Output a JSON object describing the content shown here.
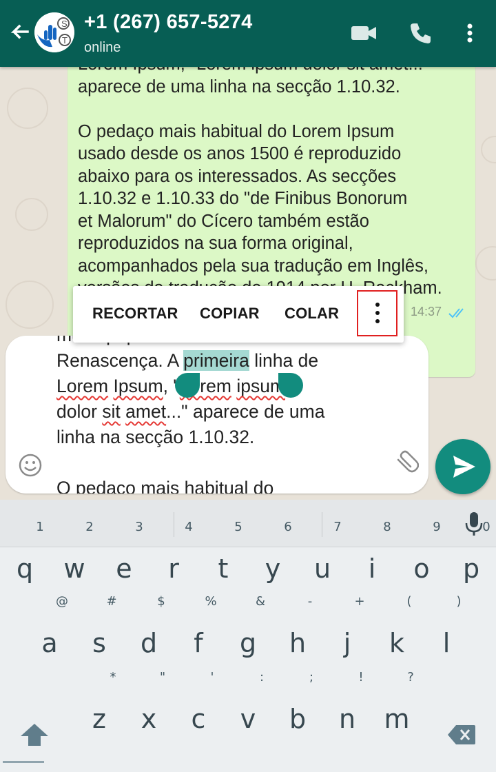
{
  "header": {
    "contact_name": "+1 (267) 657-5274",
    "status": "online",
    "icons": [
      "back-arrow-icon",
      "avatar",
      "video-call-icon",
      "phone-icon",
      "more-vert-icon"
    ],
    "bg_color": "#075e54"
  },
  "message": {
    "text": "Lorem Ipsum, \"Lorem ipsum dolor sit amet...\"\naparece de uma linha na secção 1.10.32.\n\nO pedaço mais habitual do Lorem Ipsum\nusado desde os anos 1500 é reproduzido\nabaixo para os interessados. As secções\n1.10.32 e 1.10.33 do \"de Finibus Bonorum\net Malorum\" do Cícero também estão\nreproduzidos na sua forma original,\nacompanhados pela sua tradução em Inglês,\nversões da tradução de 1914 por H. Rackham.",
    "time": "14:37",
    "bubble_color": "#dcf8c6"
  },
  "context_menu": {
    "cut": "RECORTAR",
    "copy": "COPIAR",
    "paste": "COLAR"
  },
  "input": {
    "line0": "muito popular durante a",
    "line1_pre": "Renascença. A ",
    "line1_sel": "primeira",
    "line1_post": " linha de",
    "line2_a": "Lorem",
    "line2_b": " ",
    "line2_c": "Ipsum",
    "line2_d": ", \"",
    "line2_e": "Lorem",
    "line2_f": " ",
    "line2_g": "ipsum",
    "line3_a": "dolor ",
    "line3_b": "sit",
    "line3_c": " ",
    "line3_d": "amet",
    "line3_e": "...\" aparece de uma",
    "line4": "linha na secção 1.10.32.",
    "line5": "",
    "line6": "O pedaço mais habitual do",
    "selection_color": "#a5d9d2",
    "spellcheck_color": "#e53935"
  },
  "keyboard": {
    "row1": [
      {
        "k": "q",
        "h": "1"
      },
      {
        "k": "w",
        "h": "2"
      },
      {
        "k": "e",
        "h": "3"
      },
      {
        "k": "r",
        "h": "4"
      },
      {
        "k": "t",
        "h": "5"
      },
      {
        "k": "y",
        "h": "6"
      },
      {
        "k": "u",
        "h": "7"
      },
      {
        "k": "i",
        "h": "8"
      },
      {
        "k": "o",
        "h": "9"
      },
      {
        "k": "p",
        "h": "0"
      }
    ],
    "row2": [
      {
        "k": "a",
        "h": "@"
      },
      {
        "k": "s",
        "h": "#"
      },
      {
        "k": "d",
        "h": "$"
      },
      {
        "k": "f",
        "h": "%"
      },
      {
        "k": "g",
        "h": "&"
      },
      {
        "k": "h",
        "h": "-"
      },
      {
        "k": "j",
        "h": "+"
      },
      {
        "k": "k",
        "h": "("
      },
      {
        "k": "l",
        "h": ")"
      }
    ],
    "row3": [
      {
        "k": "z",
        "h": "*"
      },
      {
        "k": "x",
        "h": "\""
      },
      {
        "k": "c",
        "h": "'"
      },
      {
        "k": "v",
        "h": ":"
      },
      {
        "k": "b",
        "h": ";"
      },
      {
        "k": "n",
        "h": "!"
      },
      {
        "k": "m",
        "h": "?"
      }
    ],
    "special_icons": [
      "shift-icon",
      "backspace-icon",
      "mic-icon"
    ]
  },
  "send_icon": "send-icon",
  "accent_color": "#128c7e"
}
